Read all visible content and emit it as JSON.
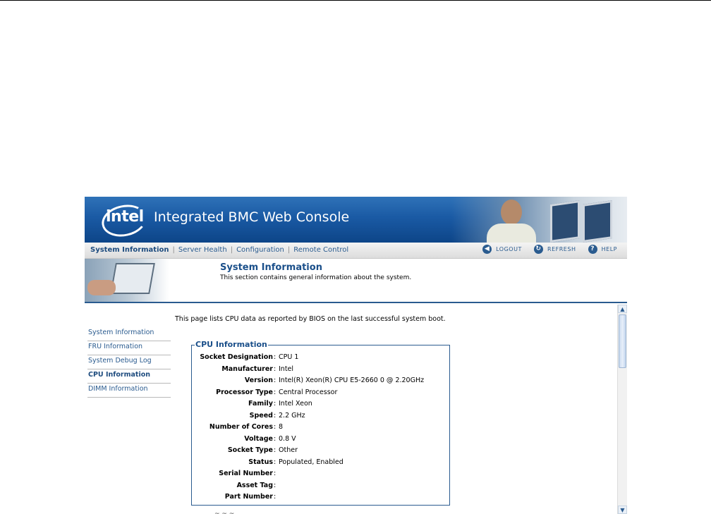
{
  "banner": {
    "logo_text": "intel",
    "title": "Integrated BMC Web Console"
  },
  "nav": {
    "links": [
      "System Information",
      "Server Health",
      "Configuration",
      "Remote Control"
    ],
    "separator": "|",
    "active": "System Information",
    "actions": [
      {
        "label": "LOGOUT",
        "icon": "logout-icon",
        "glyph": "◀"
      },
      {
        "label": "REFRESH",
        "icon": "refresh-icon",
        "glyph": "↻"
      },
      {
        "label": "HELP",
        "icon": "help-icon",
        "glyph": "?"
      }
    ]
  },
  "header": {
    "title": "System Information",
    "subtitle": "This section contains general information about the system."
  },
  "sidebar": {
    "items": [
      "System Information",
      "FRU Information",
      "System Debug Log",
      "CPU Information",
      "DIMM Information"
    ],
    "active": "CPU Information"
  },
  "content": {
    "intro": "This page lists CPU data as reported by BIOS on the last successful system boot.",
    "cpu_box": {
      "legend": "CPU Information",
      "rows": [
        {
          "label": "Socket Designation",
          "value": "CPU 1"
        },
        {
          "label": "Manufacturer",
          "value": "Intel"
        },
        {
          "label": "Version",
          "value": "Intel(R) Xeon(R) CPU E5-2660 0 @ 2.20GHz"
        },
        {
          "label": "Processor Type",
          "value": "Central Processor"
        },
        {
          "label": "Family",
          "value": "Intel Xeon"
        },
        {
          "label": "Speed",
          "value": "2.2 GHz"
        },
        {
          "label": "Number of Cores",
          "value": "8"
        },
        {
          "label": "Voltage",
          "value": "0.8 V"
        },
        {
          "label": "Socket Type",
          "value": "Other"
        },
        {
          "label": "Status",
          "value": "Populated, Enabled"
        },
        {
          "label": "Serial Number",
          "value": ""
        },
        {
          "label": "Asset Tag",
          "value": ""
        },
        {
          "label": "Part Number",
          "value": ""
        }
      ]
    }
  },
  "colors": {
    "banner_blue": "#1a5aa4",
    "link_blue": "#2a5b8f",
    "title_blue": "#1a4f8a"
  }
}
